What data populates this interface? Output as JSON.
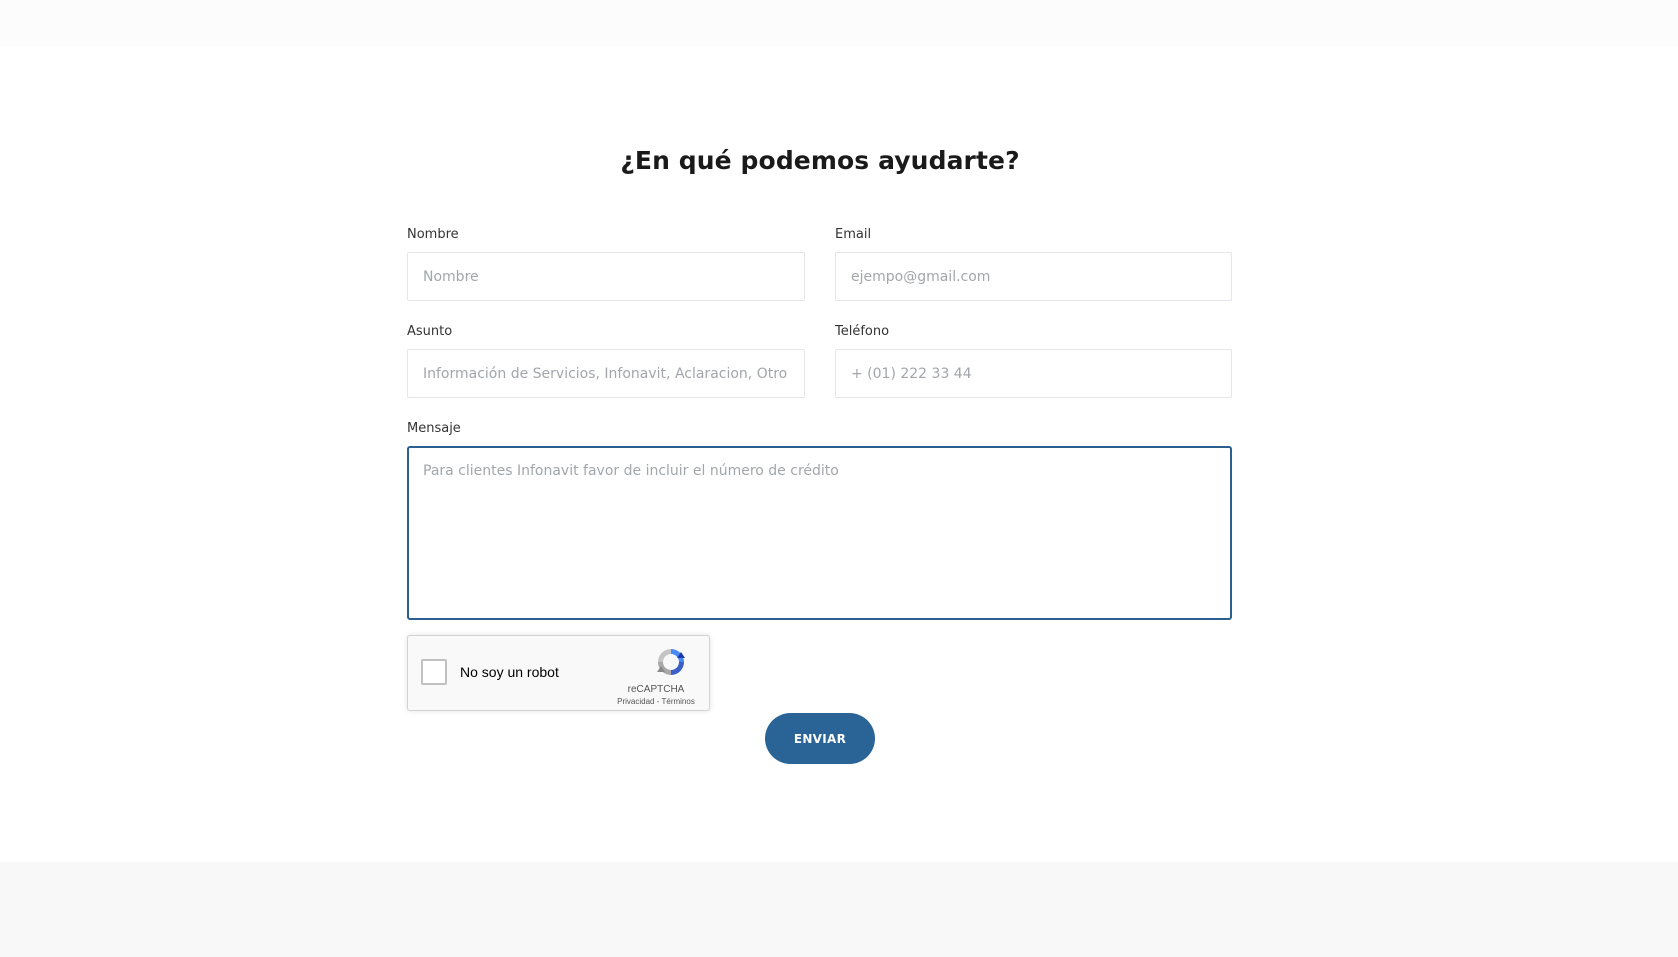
{
  "form": {
    "title": "¿En qué podemos ayudarte?",
    "fields": {
      "nombre": {
        "label": "Nombre",
        "placeholder": "Nombre"
      },
      "email": {
        "label": "Email",
        "placeholder": "ejempo@gmail.com"
      },
      "asunto": {
        "label": "Asunto",
        "placeholder": "Información de Servicios, Infonavit, Aclaracion, Otro"
      },
      "telefono": {
        "label": "Teléfono",
        "placeholder": "+ (01) 222 33 44"
      },
      "mensaje": {
        "label": "Mensaje",
        "placeholder": "Para clientes Infonavit favor de incluir el número de crédito"
      }
    },
    "recaptcha": {
      "checkbox_label": "No soy un robot",
      "brand": "reCAPTCHA",
      "privacy_link": "Privacidad",
      "separator": " - ",
      "terms_link": "Términos"
    },
    "submit_label": "ENVIAR"
  },
  "colors": {
    "accent": "#2a6496",
    "focus_border": "#2a5f8f",
    "input_border": "#e3e6ea"
  },
  "icons": {
    "recaptcha_logo": "recaptcha-logo-icon"
  }
}
